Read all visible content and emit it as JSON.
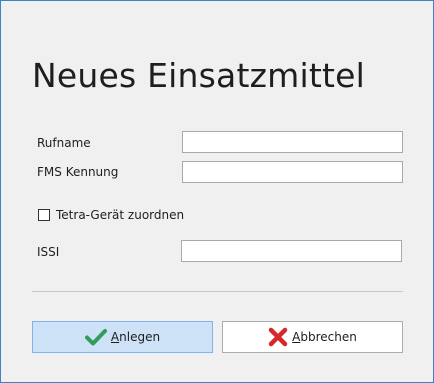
{
  "dialog": {
    "title": "Neues Einsatzmittel"
  },
  "form": {
    "rufname_label": "Rufname",
    "rufname_value": "",
    "fms_label": "FMS Kennung",
    "fms_value": "",
    "tetra_label": "Tetra-Gerät zuordnen",
    "tetra_checked": false,
    "issi_label": "ISSI",
    "issi_value": ""
  },
  "buttons": {
    "ok_mnemonic": "A",
    "ok_rest": "nlegen",
    "cancel_mnemonic": "A",
    "cancel_rest": "bbrechen"
  },
  "icons": {
    "ok": "checkmark-icon",
    "cancel": "x-icon"
  },
  "colors": {
    "frame_border": "#3c82c4",
    "ok_button_bg": "#cde1f7",
    "check_green": "#2e9e5b",
    "cross_red": "#d8262a"
  }
}
